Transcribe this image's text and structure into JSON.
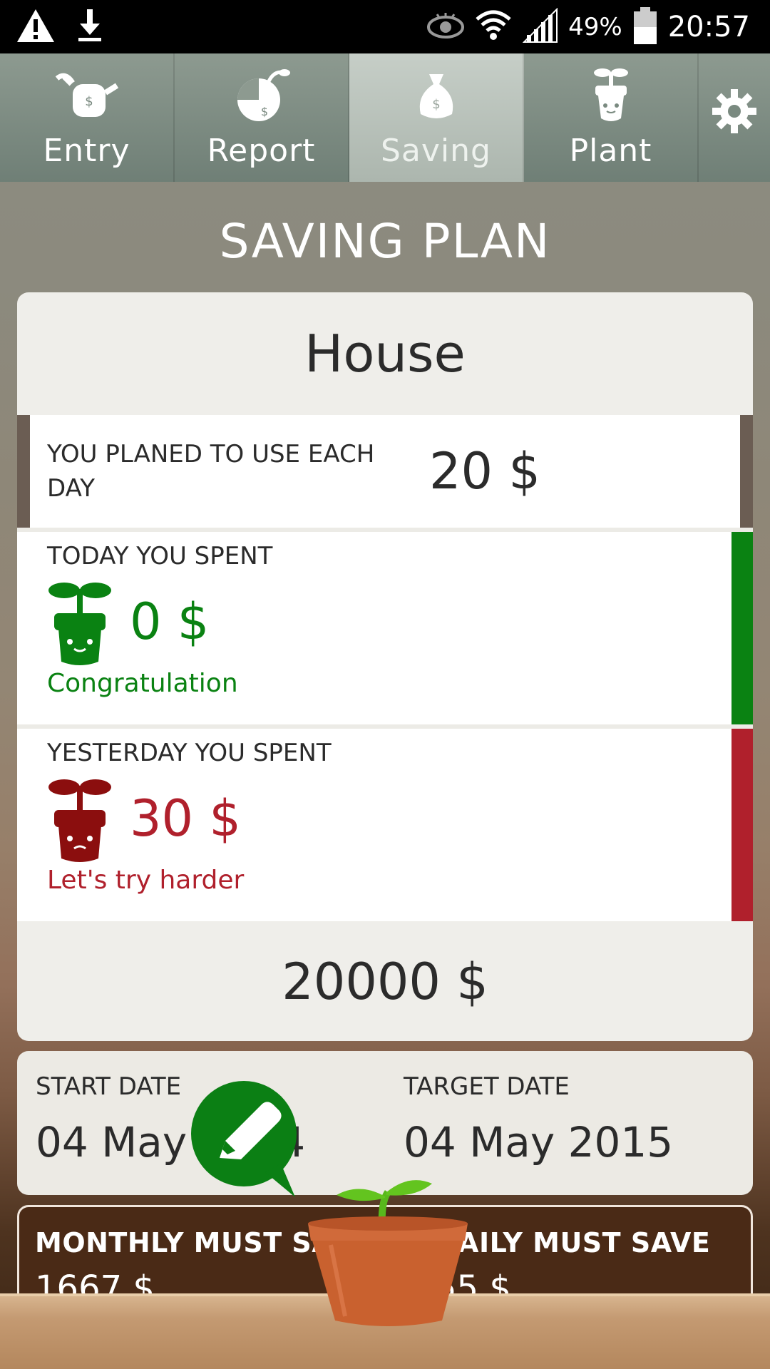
{
  "status_bar": {
    "battery_percent": "49%",
    "time": "20:57"
  },
  "tabs": [
    {
      "label": "Entry",
      "icon": "watering-can-icon"
    },
    {
      "label": "Report",
      "icon": "pie-chart-icon"
    },
    {
      "label": "Saving",
      "icon": "money-bag-icon",
      "active": true
    },
    {
      "label": "Plant",
      "icon": "sprout-icon"
    }
  ],
  "settings_icon": "gear-icon",
  "page_title": "SAVING PLAN",
  "plan": {
    "name": "House",
    "daily_label": "YOU PLANED TO USE EACH DAY",
    "daily_value": "20 $",
    "today": {
      "label": "TODAY YOU SPENT",
      "value": "0 $",
      "message": "Congratulation",
      "color": "#0a8212"
    },
    "yesterday": {
      "label": "YESTERDAY YOU SPENT",
      "value": "30 $",
      "message": "Let's try harder",
      "color": "#b0202c"
    },
    "total": "20000 $"
  },
  "dates": {
    "start_label": "START DATE",
    "start_value": "04 May 2014",
    "target_label": "TARGET DATE",
    "target_value": "04 May 2015"
  },
  "must_save": {
    "monthly_label": "MONTHLY MUST SAVE",
    "monthly_value": "1667 $",
    "daily_label": "DAILY MUST SAVE",
    "daily_value": "55 $"
  },
  "colors": {
    "accent_green": "#0a8212",
    "accent_red": "#b0202c",
    "plan_bar": "#6b5d53"
  }
}
